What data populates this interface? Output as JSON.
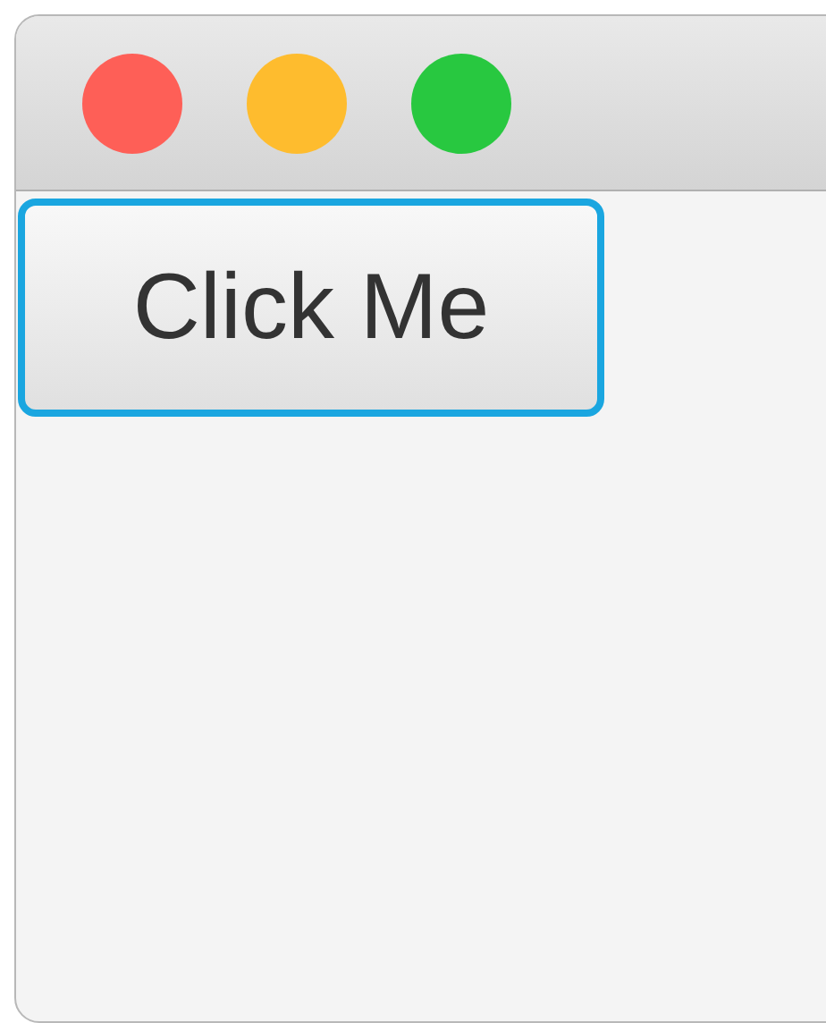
{
  "window": {
    "controls": [
      {
        "color": "#fe5f57"
      },
      {
        "color": "#febc2e"
      },
      {
        "color": "#28c840"
      }
    ]
  },
  "button": {
    "label": "Click Me",
    "focused": true
  }
}
